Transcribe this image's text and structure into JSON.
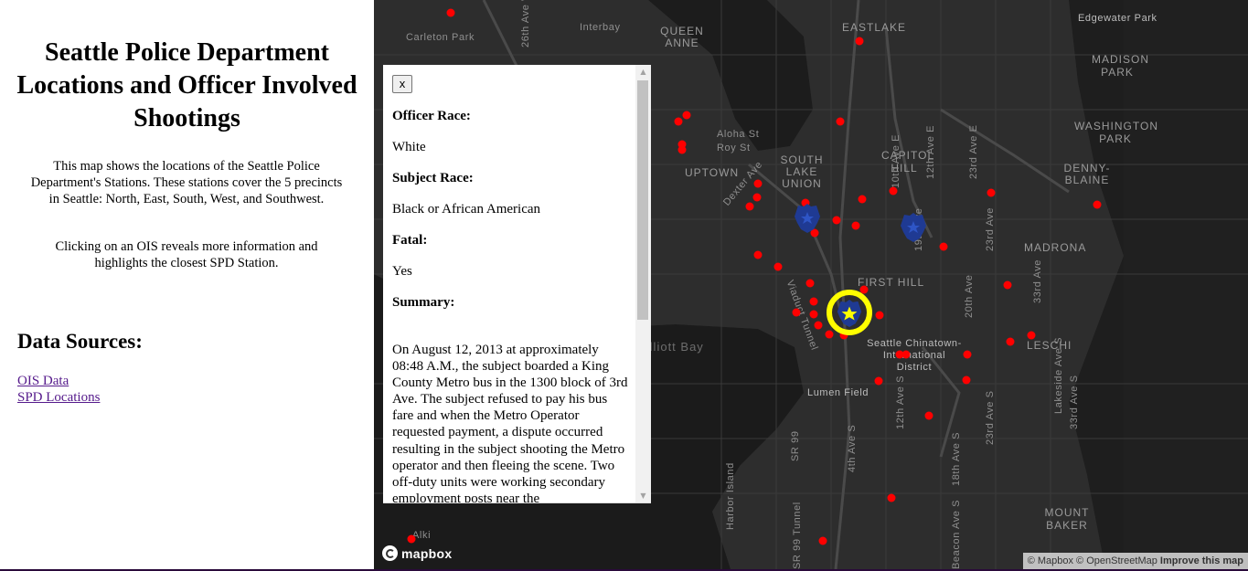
{
  "sidebar": {
    "title": "Seattle Police Department Locations and Officer Involved Shootings",
    "description_1": "This map shows the locations of the Seattle Police Department's Stations. These stations cover the 5 precincts in Seattle: North, East, South, West, and Southwest.",
    "description_2": "Clicking on an OIS reveals more information and highlights the closest SPD Station.",
    "sources_heading": "Data Sources:",
    "links": [
      "OIS Data",
      "SPD Locations"
    ]
  },
  "popup": {
    "close_label": "x",
    "officer_race_label": "Officer Race:",
    "officer_race": "White",
    "subject_race_label": "Subject Race:",
    "subject_race": "Black or African American",
    "fatal_label": "Fatal:",
    "fatal": "Yes",
    "summary_label": "Summary:",
    "summary": "On August 12, 2013 at approximately 08:48 A.M., the subject boarded a King County Metro bus in the 1300 block of 3rd Ave. The subject refused to pay his bus fare and when the Metro Operator requested payment, a dispute occurred resulting in the subject shooting the Metro operator and then fleeing the scene. Two off-duty units were working secondary employment posts near the"
  },
  "map": {
    "labels": [
      "Carleton Park",
      "26th Ave W",
      "Interbay",
      "QUEEN ANNE",
      "EASTLAKE",
      "Edgewater Park",
      "MADISON PARK",
      "Aloha St",
      "Roy St",
      "UPTOWN",
      "SOUTH LAKE UNION",
      "CAPITOL HILL",
      "WASHINGTON PARK",
      "DENNY-BLAINE",
      "MADRONA",
      "FIRST HILL",
      "Seattle Chinatown-International District",
      "LESCHI",
      "Lumen Field",
      "MOUNT BAKER",
      "Harbor Island",
      "Elliott Bay",
      "Alki",
      "19th Ave",
      "23rd Ave",
      "20th Ave",
      "33rd Ave",
      "12th Ave E",
      "10th Ave E",
      "23rd Ave E",
      "Viaduct Tunnel",
      "Dexter Ave",
      "4th Ave S",
      "18th Ave S",
      "23rd Ave S",
      "SR 99",
      "Beacon Ave S",
      "Lakeside Ave S",
      "33rd Ave S",
      "12th Ave S",
      "SR 99 Tunnel"
    ],
    "station_icon": "police-badge-icon",
    "selected_station_highlight": "#ffff00",
    "ois_marker_color": "#ff0000",
    "station_color": "#1f3a93"
  },
  "branding": {
    "logo": "mapbox"
  },
  "attribution": {
    "text": "© Mapbox © OpenStreetMap",
    "improve": "Improve this map"
  }
}
